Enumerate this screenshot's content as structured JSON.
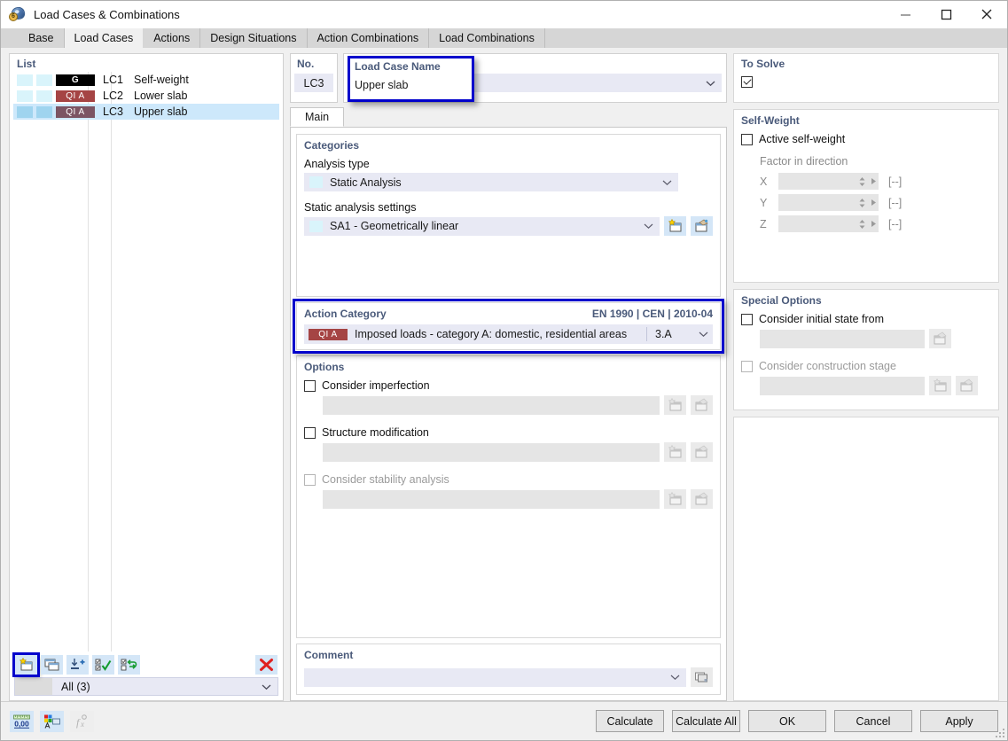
{
  "window": {
    "title": "Load Cases & Combinations",
    "icon": "load-case-icon",
    "minimize": "minimize-icon",
    "maximize": "maximize-icon",
    "close": "close-icon"
  },
  "tabs": [
    {
      "label": "Base",
      "active": false
    },
    {
      "label": "Load Cases",
      "active": true
    },
    {
      "label": "Actions",
      "active": false
    },
    {
      "label": "Design Situations",
      "active": false
    },
    {
      "label": "Action Combinations",
      "active": false
    },
    {
      "label": "Load Combinations",
      "active": false
    }
  ],
  "list": {
    "legend": "List",
    "rows": [
      {
        "tag": "G",
        "tag_style": "G",
        "no": "LC1",
        "name": "Self-weight",
        "selected": false
      },
      {
        "tag": "QI A",
        "tag_style": "QIA",
        "no": "LC2",
        "name": "Lower slab",
        "selected": false
      },
      {
        "tag": "QI A",
        "tag_style": "QIA",
        "no": "LC3",
        "name": "Upper slab",
        "selected": true
      }
    ],
    "toolbar": [
      {
        "name": "new-load-case-button",
        "icon": "new-window-star-icon",
        "highlighted": true
      },
      {
        "name": "copy-load-case-button",
        "icon": "copy-windows-icon",
        "highlighted": false
      },
      {
        "name": "import-load-case-button",
        "icon": "import-plus-icon",
        "highlighted": false
      },
      {
        "name": "select-all-button",
        "icon": "checklist-check-icon",
        "highlighted": false
      },
      {
        "name": "invert-selection-button",
        "icon": "checklist-refresh-icon",
        "highlighted": false
      }
    ],
    "delete_button": {
      "name": "delete-button",
      "icon": "red-x-icon"
    },
    "filter": {
      "label": "All (3)",
      "chevron": "chevron-down-icon"
    }
  },
  "header": {
    "no_label": "No.",
    "no_value": "LC3",
    "name_label": "Load Case Name",
    "name_value": "Upper slab",
    "name_chevron": "chevron-down-icon"
  },
  "to_solve": {
    "title": "To Solve",
    "checked": true
  },
  "inner_tabs": [
    {
      "label": "Main",
      "active": true
    }
  ],
  "categories": {
    "title": "Categories",
    "analysis_type_label": "Analysis type",
    "analysis_type_value": "Static Analysis",
    "static_settings_label": "Static analysis settings",
    "static_settings_value": "SA1 - Geometrically linear",
    "new_button": "new-window-star-icon",
    "edit_button": "edit-window-icon"
  },
  "action_category": {
    "title": "Action Category",
    "code": "EN 1990 | CEN | 2010-04",
    "tag": "QI A",
    "text": "Imposed loads - category A: domestic, residential areas",
    "sub": "3.A",
    "chevron": "chevron-down-icon",
    "highlighted": true
  },
  "options": {
    "title": "Options",
    "items": [
      {
        "label": "Consider imperfection",
        "checked": false,
        "disabled": false,
        "buttons": [
          "new-window-star-icon",
          "edit-window-icon"
        ]
      },
      {
        "label": "Structure modification",
        "checked": false,
        "disabled": false,
        "buttons": [
          "new-window-star-icon",
          "edit-window-icon"
        ]
      },
      {
        "label": "Consider stability analysis",
        "checked": false,
        "disabled": true,
        "buttons": [
          "new-window-star-icon",
          "edit-window-icon"
        ]
      }
    ]
  },
  "comment": {
    "title": "Comment",
    "value": "",
    "chevron": "chevron-down-icon",
    "button": "comment-library-icon"
  },
  "self_weight": {
    "title": "Self-Weight",
    "active_label": "Active self-weight",
    "active_checked": false,
    "factor_label": "Factor in direction",
    "axes": [
      {
        "axis": "X",
        "value": "",
        "unit": "[--]"
      },
      {
        "axis": "Y",
        "value": "",
        "unit": "[--]"
      },
      {
        "axis": "Z",
        "value": "",
        "unit": "[--]"
      }
    ]
  },
  "special_options": {
    "title": "Special Options",
    "items": [
      {
        "label": "Consider initial state from",
        "checked": false,
        "disabled": false,
        "buttons": [
          "edit-window-icon"
        ]
      },
      {
        "label": "Consider construction stage",
        "checked": false,
        "disabled": true,
        "buttons": [
          "new-window-star-icon",
          "edit-window-icon"
        ]
      }
    ]
  },
  "footer": {
    "icons": [
      {
        "name": "units-decimals-button",
        "icon": "number-format-icon",
        "disabled": false,
        "label": "0,00"
      },
      {
        "name": "display-properties-button",
        "icon": "color-palette-icon",
        "disabled": false
      },
      {
        "name": "formula-button",
        "icon": "function-icon",
        "disabled": true
      }
    ],
    "buttons": [
      {
        "label": "Calculate",
        "name": "calculate-button"
      },
      {
        "label": "Calculate All",
        "name": "calculate-all-button"
      },
      {
        "label": "OK",
        "name": "ok-button"
      },
      {
        "label": "Cancel",
        "name": "cancel-button"
      },
      {
        "label": "Apply",
        "name": "apply-button"
      }
    ]
  },
  "colors": {
    "highlight_blue": "#0000cc",
    "field_bg": "#e8e9f4",
    "legend_text": "#4a5a7a",
    "selection": "#cde8fb",
    "tag_g": "#000000",
    "tag_qia": "#a54444",
    "tag_qia_selected": "#7c5463",
    "delete_red": "#e02020"
  }
}
